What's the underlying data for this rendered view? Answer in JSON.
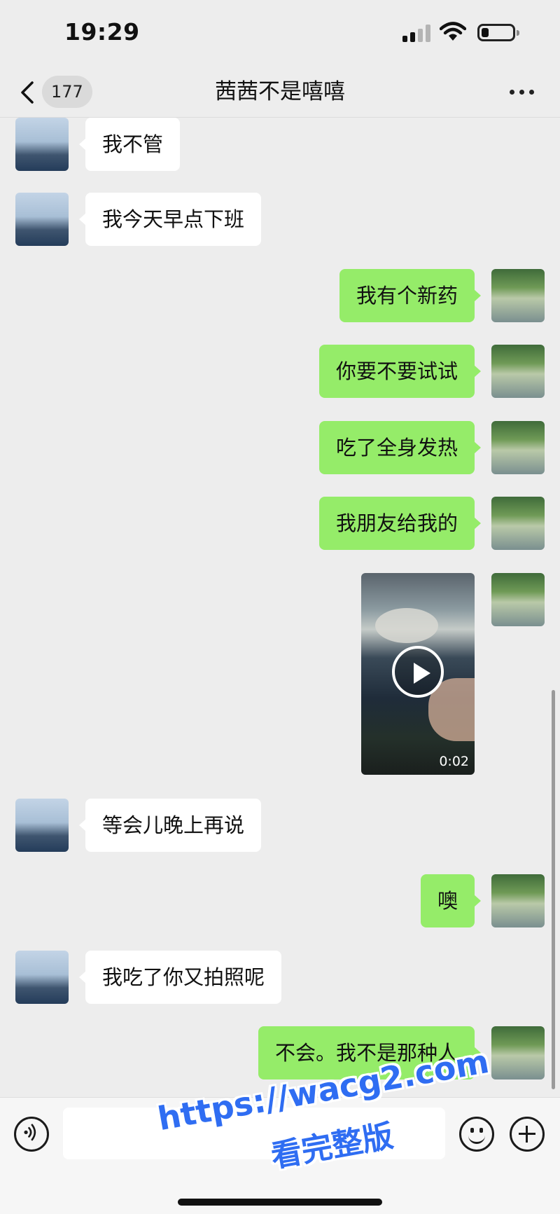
{
  "status_bar": {
    "time": "19:29"
  },
  "nav": {
    "badge": "177",
    "title": "茜茜不是嘻嘻"
  },
  "messages": [
    {
      "sender": "friend",
      "text": "我不管"
    },
    {
      "sender": "friend",
      "text": "我今天早点下班"
    },
    {
      "sender": "self",
      "text": "我有个新药"
    },
    {
      "sender": "self",
      "text": "你要不要试试"
    },
    {
      "sender": "self",
      "text": "吃了全身发热"
    },
    {
      "sender": "self",
      "text": "我朋友给我的"
    },
    {
      "sender": "self",
      "type": "video",
      "duration": "0:02"
    },
    {
      "sender": "friend",
      "text": "等会儿晚上再说"
    },
    {
      "sender": "self",
      "text": "噢"
    },
    {
      "sender": "friend",
      "text": "我吃了你又拍照呢"
    },
    {
      "sender": "self",
      "text": "不会。我不是那种人"
    }
  ],
  "input": {
    "value": ""
  },
  "watermark": {
    "url": "https://wacg2.com",
    "subtitle": "看完整版"
  },
  "colors": {
    "background": "#ededed",
    "self_bubble": "#95ec69",
    "friend_bubble": "#ffffff",
    "watermark": "#2f6df2"
  }
}
